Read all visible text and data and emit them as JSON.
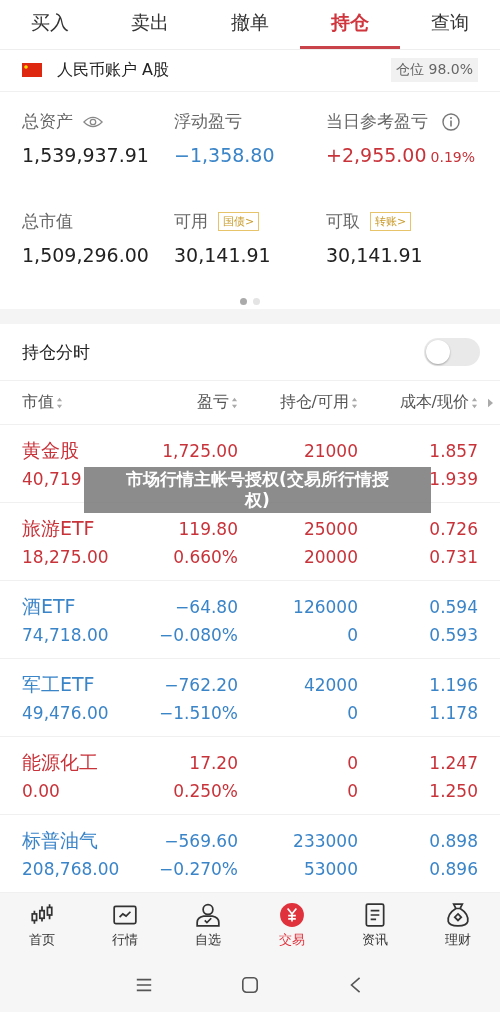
{
  "tabs": [
    {
      "label": "买入",
      "selected": false
    },
    {
      "label": "卖出",
      "selected": false
    },
    {
      "label": "撤单",
      "selected": false
    },
    {
      "label": "持仓",
      "selected": true
    },
    {
      "label": "查询",
      "selected": false
    }
  ],
  "account": {
    "name": "人民币账户 A股",
    "position": "仓位 98.0%"
  },
  "summary": [
    {
      "label": "总资产",
      "value": "1,539,937.91",
      "color": "#222222"
    },
    {
      "label": "浮动盈亏",
      "value": "−1,358.80",
      "color": "#3a84c8"
    },
    {
      "label": "当日参考盈亏",
      "value": "+2,955.00",
      "pct": "0.19%",
      "color": "#c8333a"
    },
    {
      "label": "总市值",
      "value": "1,509,296.00",
      "color": "#222222"
    },
    {
      "label": "可用",
      "tag": "国债>",
      "value": "30,141.91",
      "color": "#222222"
    },
    {
      "label": "可取",
      "tag": "转账>",
      "value": "30,141.91",
      "color": "#222222"
    }
  ],
  "pages": [
    {
      "selected": true
    },
    {
      "selected": false
    }
  ],
  "timeline": {
    "label": "持仓分时",
    "on": false
  },
  "columns": [
    "市值",
    "盈亏",
    "持仓/可用",
    "成本/现价"
  ],
  "rows": [
    {
      "name": "黄金股",
      "color": "#c8333a",
      "pl": "1,725.00",
      "hold": "21000",
      "cost": "1.857",
      "value": "40,719",
      "price": "1.939"
    },
    {
      "name": "旅游ETF",
      "color": "#c8333a",
      "pl": "119.80",
      "hold": "25000",
      "cost": "0.726",
      "value": "18,275.00",
      "pct": "0.660%",
      "avail": "20000",
      "price": "0.731"
    },
    {
      "name": "酒ETF",
      "color": "#3a84c8",
      "pl": "−64.80",
      "hold": "126000",
      "cost": "0.594",
      "value": "74,718.00",
      "pct": "−0.080%",
      "avail": "0",
      "price": "0.593"
    },
    {
      "name": "军工ETF",
      "color": "#3a84c8",
      "pl": "−762.20",
      "hold": "42000",
      "cost": "1.196",
      "value": "49,476.00",
      "pct": "−1.510%",
      "avail": "0",
      "price": "1.178"
    },
    {
      "name": "能源化工",
      "color": "#c8333a",
      "pl": "17.20",
      "hold": "0",
      "cost": "1.247",
      "value": "0.00",
      "pct": "0.250%",
      "avail": "0",
      "price": "1.250"
    },
    {
      "name": "标普油气",
      "color": "#3a84c8",
      "pl": "−569.60",
      "hold": "233000",
      "cost": "0.898",
      "value": "208,768.00",
      "pct": "−0.270%",
      "avail": "53000",
      "price": "0.896"
    }
  ],
  "toast": "市场行情主帐号授权(交易所行情授权)",
  "nav": [
    {
      "label": "首页",
      "selected": false
    },
    {
      "label": "行情",
      "selected": false
    },
    {
      "label": "自选",
      "selected": false
    },
    {
      "label": "交易",
      "selected": true
    },
    {
      "label": "资讯",
      "selected": false
    },
    {
      "label": "理财",
      "selected": false
    }
  ]
}
